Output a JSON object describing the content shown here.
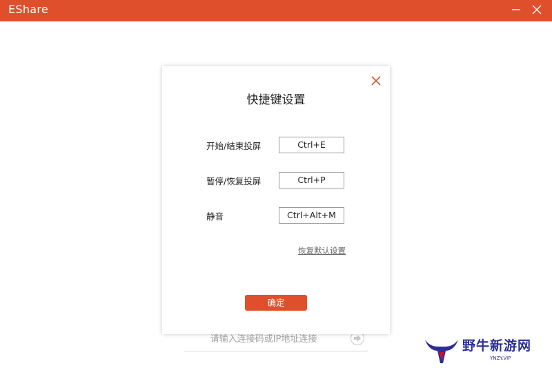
{
  "app": {
    "title": "EShare"
  },
  "colors": {
    "accent": "#e04f2c",
    "watermark": "#2b2f93"
  },
  "background": {
    "connect_placeholder": "请输入连接码或IP地址连接"
  },
  "dialog": {
    "title": "快捷键设置",
    "rows": [
      {
        "label": "开始/结束投屏",
        "key": "Ctrl+E"
      },
      {
        "label": "暂停/恢复投屏",
        "key": "Ctrl+P"
      },
      {
        "label": "静音",
        "key": "Ctrl+Alt+M"
      }
    ],
    "reset_label": "恢复默认设置",
    "ok_label": "确定"
  },
  "watermark": {
    "text": "野牛新游网",
    "sub": "YNZY.VIP"
  }
}
